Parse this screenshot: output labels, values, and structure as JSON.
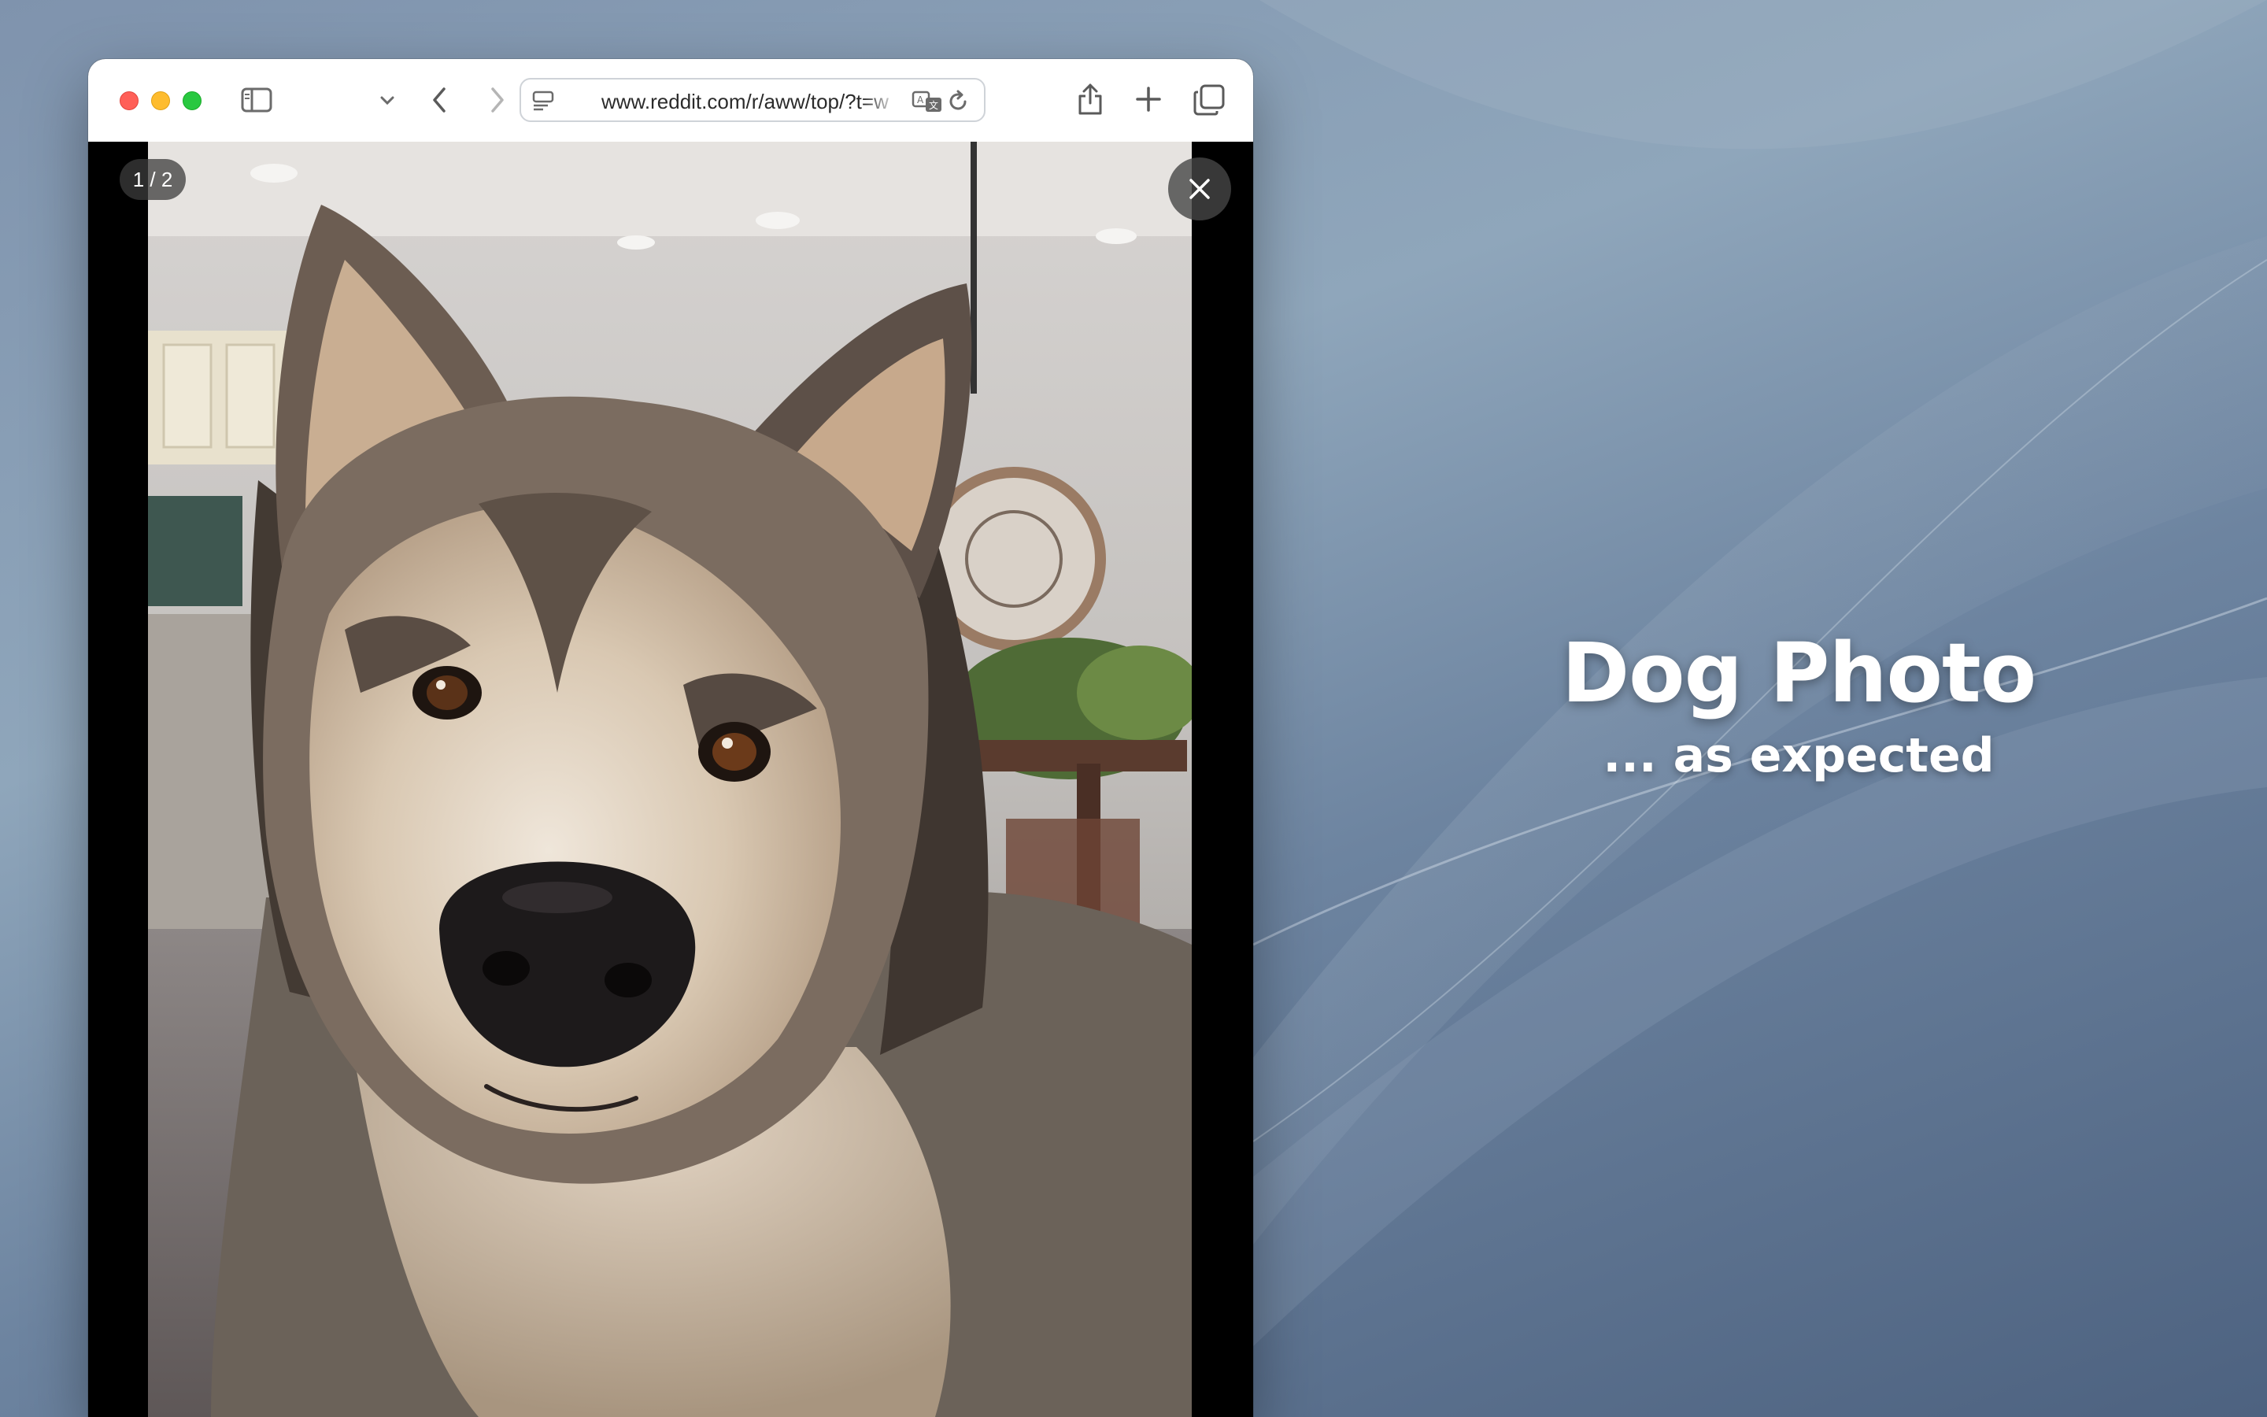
{
  "browser": {
    "url": "www.reddit.com/r/aww/top/?t=w",
    "icons": {
      "sidebar": "sidebar-icon",
      "sidebar_menu": "chevron-down-icon",
      "back": "chevron-left-icon",
      "forward": "chevron-right-icon",
      "extension": "extension-icon",
      "reader": "reader-icon",
      "translate": "translate-icon",
      "reload": "reload-icon",
      "share": "share-icon",
      "new_tab": "plus-icon",
      "tabs": "tab-overview-icon"
    }
  },
  "viewer": {
    "counter": "1 / 2",
    "close_icon": "close-icon",
    "image_subject": "dog"
  },
  "caption": {
    "title": "Dog Photo",
    "subtitle": "... as expected"
  },
  "colors": {
    "traffic_red": "#ff5f57",
    "traffic_yellow": "#febc2e",
    "traffic_green": "#28c840",
    "extension_blue": "#1a6fd1"
  }
}
